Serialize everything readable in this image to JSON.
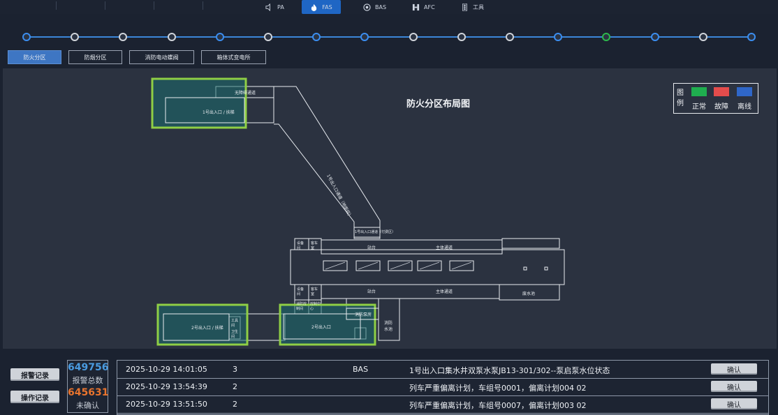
{
  "nav": {
    "tabs": [
      {
        "label": "PA",
        "icon": "speaker-icon",
        "active": false
      },
      {
        "label": "FAS",
        "icon": "fire-icon",
        "active": true
      },
      {
        "label": "BAS",
        "icon": "fan-icon",
        "active": false
      },
      {
        "label": "AFC",
        "icon": "gate-icon",
        "active": false
      },
      {
        "label": "工具",
        "icon": "traffic-light-icon",
        "active": false
      }
    ]
  },
  "timeline": {
    "stations": [
      "blue",
      "gray",
      "gray",
      "gray",
      "blue",
      "gray",
      "blue",
      "blue",
      "gray",
      "gray",
      "gray",
      "blue",
      "green",
      "blue",
      "gray",
      "blue"
    ]
  },
  "zone_tabs": [
    "防火分区",
    "防烟分区",
    "消防电动蝶阀",
    "箱体式变电所"
  ],
  "plan": {
    "title": "防火分区布局图",
    "legend": {
      "heading": [
        "图",
        "例"
      ],
      "items": [
        {
          "label": "正常",
          "color": "#1fae4f"
        },
        {
          "label": "故障",
          "color": "#e44c4c"
        },
        {
          "label": "离线",
          "color": "#2f67c9"
        }
      ]
    },
    "labels": {
      "barrier_free": "无障碍通道",
      "exit1": "1号出入口 / 扶梯",
      "exit1_passage": "1号出入口通道（地面段）",
      "exit1_passage_short": "1号出入口通道（付费区）",
      "equip_room_top": "设备间",
      "station_room_top": "客车室",
      "platform_top": "站台",
      "main_passage_top": "主体通道",
      "equip_room_bottom": "设备间",
      "station_room_bottom": "客车室",
      "platform_bottom": "站台",
      "main_passage_bottom": "主体通道",
      "drain_pool": "废水池",
      "fire_pump_room": "消防泵房",
      "fire_pool": "消防水池",
      "fire_ctrl_room": "消防控制间",
      "control_center": "控制中心",
      "exit2": "2号出入口",
      "exit2_escalator": "2号出入口 / 扶梯",
      "tool_room": "工具间",
      "toilet": "卫生间"
    }
  },
  "buttons": {
    "alarm_record": "报警记录",
    "operation_record": "操作记录"
  },
  "stats": {
    "total_value": "649756",
    "total_label": "报警总数",
    "total_color": "#4a9be0",
    "unack_value": "645631",
    "unack_label": "未确认",
    "unack_color": "#e8742e"
  },
  "alarms": [
    {
      "time": "2025-10-29 14:01:05",
      "level": "3",
      "system": "BAS",
      "desc": "1号出入口集水井双泵水泵JB13-301/302--泵启泵水位状态",
      "action": "确认"
    },
    {
      "time": "2025-10-29 13:54:39",
      "level": "2",
      "system": "",
      "desc": "列车严重偏离计划，车组号0001，偏离计划004  02",
      "action": "确认"
    },
    {
      "time": "2025-10-29 13:51:50",
      "level": "2",
      "system": "",
      "desc": "列车严重偏离计划，车组号0007，偏离计划003  02",
      "action": "确认"
    }
  ]
}
